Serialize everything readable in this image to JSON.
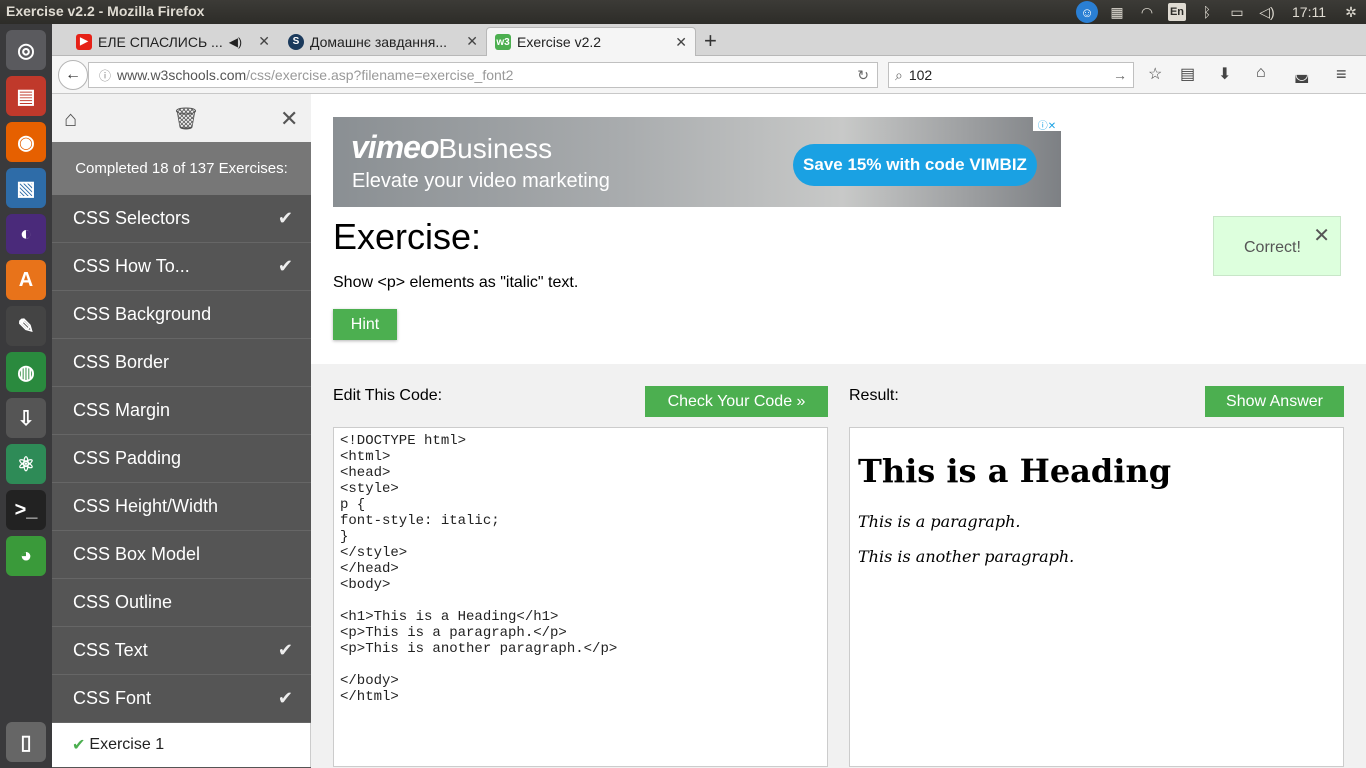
{
  "window": {
    "title": "Exercise v2.2 - Mozilla Firefox"
  },
  "tray": {
    "keyboard": "En",
    "clock": "17:11"
  },
  "tabs": [
    {
      "label": "ЕЛЕ СПАСЛИСЬ ...",
      "favicon": "youtube-icon"
    },
    {
      "label": "Домашнє завдання...",
      "favicon": "s-icon"
    },
    {
      "label": "Exercise v2.2",
      "favicon": "w3-icon"
    }
  ],
  "navbar": {
    "url_host": "www.w3schools.com",
    "url_path": "/css/exercise.asp?filename=exercise_font2",
    "search_value": "102"
  },
  "sidebar": {
    "progress": "Completed 18 of 137 Exercises:",
    "items": [
      {
        "label": "CSS Selectors",
        "done": true
      },
      {
        "label": "CSS How To...",
        "done": true
      },
      {
        "label": "CSS Background",
        "done": false
      },
      {
        "label": "CSS Border",
        "done": false
      },
      {
        "label": "CSS Margin",
        "done": false
      },
      {
        "label": "CSS Padding",
        "done": false
      },
      {
        "label": "CSS Height/Width",
        "done": false
      },
      {
        "label": "CSS Box Model",
        "done": false
      },
      {
        "label": "CSS Outline",
        "done": false
      },
      {
        "label": "CSS Text",
        "done": true
      },
      {
        "label": "CSS Font",
        "done": true
      }
    ],
    "sub_item": "Exercise 1"
  },
  "ad": {
    "brand": "vimeo",
    "brand_suffix": "Business",
    "subtitle": "Elevate your video marketing",
    "cta": "Save 15% with code VIMBIZ"
  },
  "exercise": {
    "title": "Exercise:",
    "description": "Show <p> elements as \"italic\" text.",
    "hint_label": "Hint",
    "status": "Correct!"
  },
  "editor": {
    "label": "Edit This Code:",
    "check_label": "Check Your Code »",
    "code": "<!DOCTYPE html>\n<html>\n<head>\n<style>\np {\nfont-style: italic;\n}\n</style>\n</head>\n<body>\n\n<h1>This is a Heading</h1>\n<p>This is a paragraph.</p>\n<p>This is another paragraph.</p>\n\n</body>\n</html>"
  },
  "result": {
    "label": "Result:",
    "show_answer_label": "Show Answer",
    "heading": "This is a Heading",
    "paragraphs": [
      "This is a paragraph.",
      "This is another paragraph."
    ]
  }
}
